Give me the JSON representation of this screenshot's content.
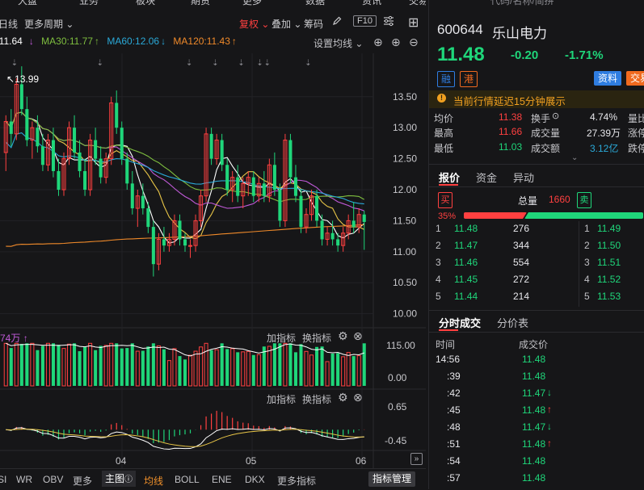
{
  "top_nav": [
    "大盘",
    "业务",
    "板块",
    "期货",
    "更多",
    "数据",
    "资讯",
    "交易"
  ],
  "search_placeholder": "代码/名称/简拼",
  "toolbar": {
    "left_label": "日线",
    "period_more": "更多周期",
    "fuquan": "复权",
    "diejia": "叠加",
    "chouma": "筹码",
    "f10": "F10"
  },
  "ma_bar": {
    "ma_first": "MA10:11.64",
    "ma30": "MA30:11.77",
    "ma60": "MA60:12.06",
    "ma120": "MA120:11.43",
    "settings": "设置均线"
  },
  "price_axis": [
    "13.50",
    "13.00",
    "12.50",
    "12.00",
    "11.50",
    "11.00",
    "10.50",
    "10.00"
  ],
  "high_label": "13.99",
  "volume_panel": {
    "label": "74万",
    "add": "加指标",
    "switch": "换指标",
    "axis": [
      "115.00",
      "0.00"
    ]
  },
  "macd_panel": {
    "add": "加指标",
    "switch": "换指标",
    "axis": [
      "0.65",
      "-0.45"
    ]
  },
  "date_axis": [
    "04",
    "05",
    "06"
  ],
  "bottom_bar": [
    "SI",
    "WR",
    "OBV",
    "更多",
    "主图",
    "均线",
    "BOLL",
    "ENE",
    "DKX",
    "更多指标",
    "指标管理"
  ],
  "stock": {
    "code": "600644",
    "name": "乐山电力",
    "price": "11.48",
    "change": "-0.20",
    "change_pct": "-1.71%",
    "tag_rong": "融",
    "tag_gang": "港",
    "btn_info": "资料",
    "btn_trade": "交易"
  },
  "delay_notice": "当前行情延迟15分钟展示",
  "stats": [
    [
      "均价",
      "11.38",
      "换手",
      "4.74%",
      "量比"
    ],
    [
      "最高",
      "11.66",
      "成交量",
      "27.39万",
      "涨停"
    ],
    [
      "最低",
      "11.03",
      "成交额",
      "3.12亿",
      "跌停"
    ]
  ],
  "quote_tabs": [
    "报价",
    "资金",
    "异动"
  ],
  "buy_label": "买",
  "sell_label": "卖",
  "total_label": "总量",
  "total_value": "1660",
  "buy_pct": "35%",
  "buy_pct_value": 0.35,
  "bids": [
    [
      "1",
      "11.48",
      "276"
    ],
    [
      "2",
      "11.47",
      "344"
    ],
    [
      "3",
      "11.46",
      "554"
    ],
    [
      "4",
      "11.45",
      "272"
    ],
    [
      "5",
      "11.44",
      "214"
    ]
  ],
  "asks": [
    [
      "1",
      "11.49"
    ],
    [
      "2",
      "11.50"
    ],
    [
      "3",
      "11.51"
    ],
    [
      "4",
      "11.52"
    ],
    [
      "5",
      "11.53"
    ]
  ],
  "trade_tabs": [
    "分时成交",
    "分价表"
  ],
  "trade_headers": [
    "时间",
    "成交价"
  ],
  "trades": [
    [
      "14:56",
      "11.48",
      ""
    ],
    [
      ":39",
      "11.48",
      ""
    ],
    [
      ":42",
      "11.47",
      "down"
    ],
    [
      ":45",
      "11.48",
      "up"
    ],
    [
      ":48",
      "11.47",
      "down"
    ],
    [
      ":51",
      "11.48",
      "up"
    ],
    [
      ":54",
      "11.48",
      ""
    ],
    [
      ":57",
      "11.48",
      ""
    ]
  ],
  "colors": {
    "up": "#ff4040",
    "down": "#1fd67a",
    "ma_white": "#ffffff",
    "ma_yellow": "#e8c547",
    "ma_purple": "#c05ad8",
    "ma_green": "#7fbf3f",
    "ma_cyan": "#2aa9d8",
    "ma_orange": "#f08a2a",
    "accent_blue": "#2f7de1",
    "accent_orange": "#f06a1f"
  },
  "chart_data": {
    "type": "candlestick",
    "ylim": [
      9.8,
      14.2
    ],
    "candles": [
      [
        12.6,
        13.2,
        12.3,
        13.1
      ],
      [
        13.1,
        13.3,
        12.7,
        12.9
      ],
      [
        12.9,
        13.8,
        12.8,
        13.7
      ],
      [
        13.7,
        13.99,
        13.2,
        13.3
      ],
      [
        13.3,
        13.5,
        12.7,
        12.8
      ],
      [
        12.8,
        13.1,
        12.5,
        13.0
      ],
      [
        13.0,
        13.2,
        12.6,
        12.7
      ],
      [
        12.7,
        12.9,
        12.3,
        12.4
      ],
      [
        12.4,
        12.9,
        12.3,
        12.8
      ],
      [
        12.8,
        13.0,
        12.2,
        12.3
      ],
      [
        12.3,
        12.5,
        11.9,
        12.0
      ],
      [
        12.0,
        12.6,
        11.9,
        12.5
      ],
      [
        12.5,
        13.1,
        12.4,
        13.0
      ],
      [
        13.0,
        13.2,
        12.5,
        12.6
      ],
      [
        12.6,
        12.8,
        12.2,
        12.3
      ],
      [
        12.3,
        12.5,
        11.9,
        12.0
      ],
      [
        12.0,
        12.9,
        11.9,
        12.8
      ],
      [
        12.8,
        13.0,
        12.4,
        12.5
      ],
      [
        12.5,
        12.7,
        12.1,
        12.2
      ],
      [
        12.2,
        12.6,
        12.1,
        12.5
      ],
      [
        12.5,
        13.5,
        12.4,
        13.4
      ],
      [
        13.4,
        13.6,
        12.9,
        13.0
      ],
      [
        13.0,
        13.1,
        12.4,
        12.5
      ],
      [
        12.5,
        12.6,
        12.0,
        12.1
      ],
      [
        12.1,
        12.3,
        11.6,
        11.7
      ],
      [
        11.7,
        12.0,
        11.4,
        11.9
      ],
      [
        11.9,
        12.1,
        11.6,
        11.7
      ],
      [
        11.7,
        11.8,
        11.3,
        11.4
      ],
      [
        11.4,
        11.5,
        10.6,
        10.8
      ],
      [
        10.8,
        11.3,
        10.7,
        11.2
      ],
      [
        11.2,
        11.4,
        11.0,
        11.1
      ],
      [
        11.1,
        11.3,
        11.0,
        11.2
      ],
      [
        11.2,
        11.6,
        11.1,
        11.5
      ],
      [
        11.5,
        11.6,
        11.1,
        11.2
      ],
      [
        11.2,
        11.3,
        11.0,
        11.1
      ],
      [
        11.1,
        11.2,
        10.9,
        11.1
      ],
      [
        11.1,
        11.6,
        11.0,
        11.5
      ],
      [
        11.5,
        12.0,
        11.4,
        11.9
      ],
      [
        11.9,
        13.0,
        11.8,
        12.9
      ],
      [
        12.9,
        13.0,
        12.4,
        12.5
      ],
      [
        12.5,
        12.9,
        12.4,
        12.8
      ],
      [
        12.8,
        12.9,
        12.3,
        12.4
      ],
      [
        12.4,
        12.5,
        11.9,
        12.0
      ],
      [
        12.0,
        12.3,
        11.8,
        12.2
      ],
      [
        12.2,
        12.4,
        11.8,
        11.9
      ],
      [
        11.9,
        12.2,
        11.7,
        12.1
      ],
      [
        12.1,
        12.3,
        11.9,
        12.2
      ],
      [
        12.2,
        12.3,
        11.8,
        11.9
      ],
      [
        11.9,
        12.2,
        11.8,
        12.1
      ],
      [
        12.1,
        12.3,
        11.8,
        11.9
      ],
      [
        11.9,
        12.5,
        11.8,
        12.4
      ],
      [
        12.4,
        12.6,
        11.9,
        12.0
      ],
      [
        12.0,
        12.1,
        11.4,
        11.5
      ],
      [
        11.5,
        12.9,
        11.4,
        12.8
      ],
      [
        12.8,
        12.9,
        12.1,
        12.2
      ],
      [
        12.2,
        12.4,
        11.8,
        11.9
      ],
      [
        11.9,
        12.0,
        11.3,
        11.4
      ],
      [
        11.4,
        11.7,
        11.3,
        11.6
      ],
      [
        11.6,
        12.0,
        11.5,
        11.9
      ],
      [
        11.9,
        12.0,
        11.4,
        11.5
      ],
      [
        11.5,
        11.6,
        11.1,
        11.2
      ],
      [
        11.2,
        11.4,
        11.1,
        11.3
      ],
      [
        11.3,
        11.5,
        11.1,
        11.2
      ],
      [
        11.2,
        11.3,
        11.0,
        11.1
      ],
      [
        11.1,
        11.4,
        11.0,
        11.3
      ],
      [
        11.3,
        11.6,
        11.2,
        11.5
      ],
      [
        11.5,
        11.8,
        11.3,
        11.4
      ],
      [
        11.4,
        11.7,
        11.3,
        11.6
      ],
      [
        11.6,
        11.66,
        11.03,
        11.48
      ]
    ],
    "volume_axis": [
      0,
      115
    ],
    "macd_axis": [
      -0.45,
      0.65
    ]
  }
}
